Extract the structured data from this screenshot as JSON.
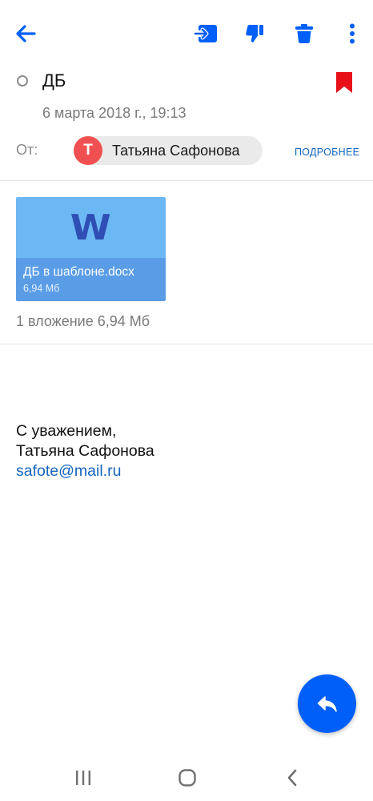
{
  "toolbar": {
    "back_icon": "arrow-left-icon",
    "move_icon": "move-to-folder-icon",
    "dislike_icon": "thumbs-down-icon",
    "delete_icon": "trash-icon",
    "more_icon": "more-vertical-icon",
    "accent_color": "#005ff9"
  },
  "message": {
    "subject": "ДБ",
    "date": "6 марта 2018 г., 19:13",
    "flag_color": "#e8111a",
    "from_label": "От:",
    "sender": {
      "initial": "Т",
      "name": "Татьяна Сафонова",
      "avatar_color": "#f05052"
    },
    "details_label": "ПОДРОБНЕЕ"
  },
  "attachments": {
    "items": [
      {
        "icon": "word-document-icon",
        "glyph": "W",
        "name": "ДБ в шаблоне.docx",
        "size": "6,94  Мб"
      }
    ],
    "summary": "1 вложение 6,94  Мб"
  },
  "body": {
    "lines": [
      "С уважением,",
      "Татьяна Сафонова"
    ],
    "email_link": "safote@mail.ru"
  },
  "fab": {
    "icon": "reply-icon"
  },
  "system_nav": {
    "recents_icon": "recents-icon",
    "home_icon": "home-icon",
    "back_icon": "back-chevron-icon"
  }
}
